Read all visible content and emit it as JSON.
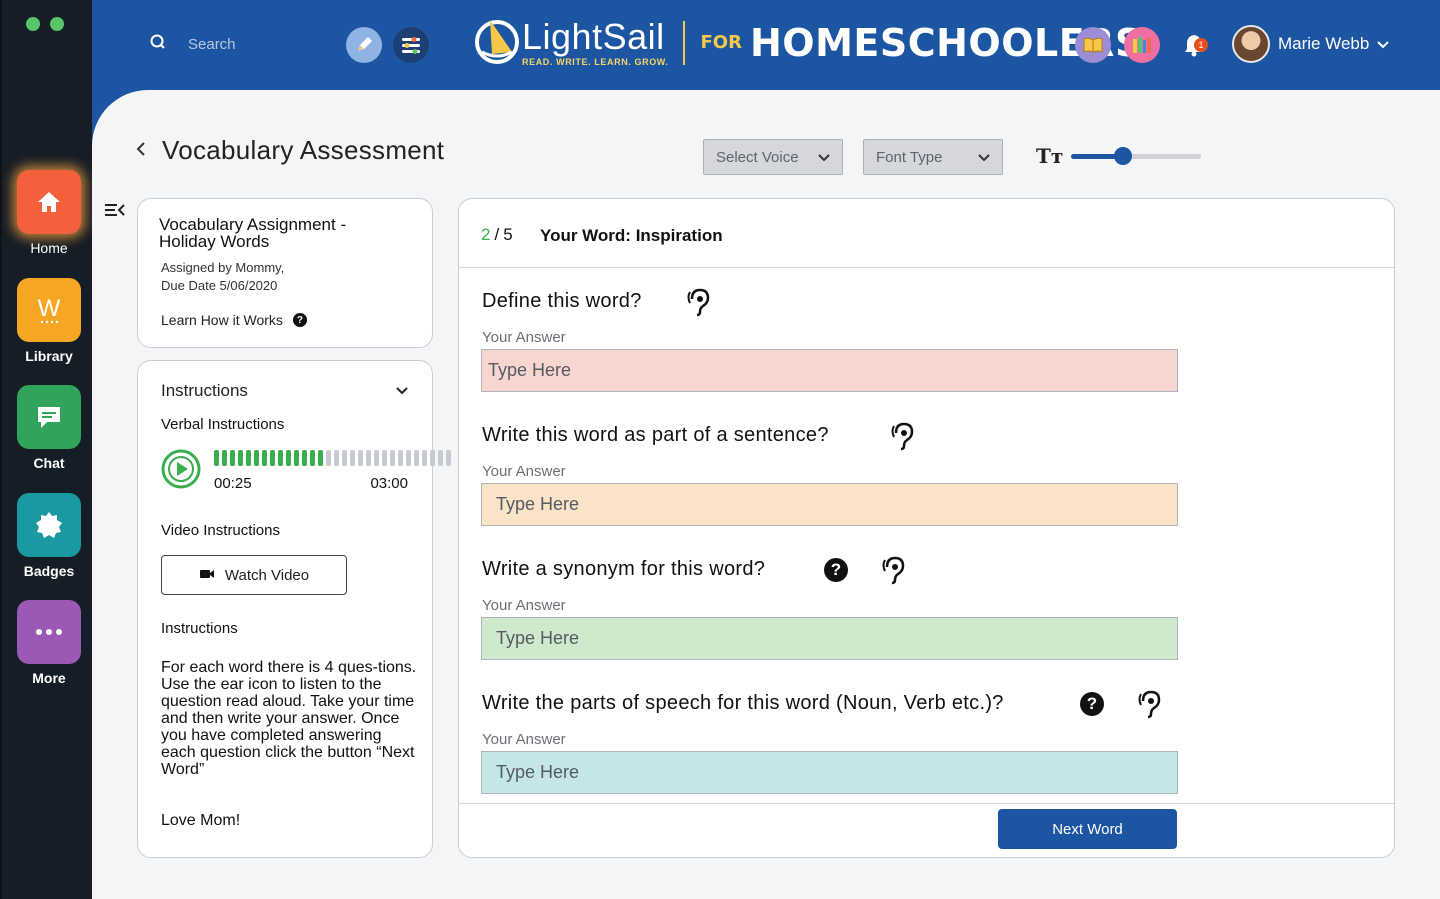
{
  "app": {
    "brand_name": "LightSail",
    "brand_tagline": "READ. WRITE. LEARN. GROW.",
    "brand_for": "FOR",
    "brand_audience": "HOMESCHOOLERS",
    "accent_color": "#1c55a2"
  },
  "header": {
    "search_placeholder": "Search",
    "notification_count": "1",
    "user_name": "Marie Webb"
  },
  "sidebar": {
    "items": [
      {
        "label": "Home",
        "icon": "home-icon",
        "color": "#f2603c"
      },
      {
        "label": "Library",
        "icon": "library-w-icon",
        "color": "#f6a623"
      },
      {
        "label": "Chat",
        "icon": "chat-icon",
        "color": "#2fa45a"
      },
      {
        "label": "Badges",
        "icon": "badge-icon",
        "color": "#1a9aa0"
      },
      {
        "label": "More",
        "icon": "more-icon",
        "color": "#9b59b6"
      }
    ]
  },
  "page": {
    "title": "Vocabulary Assessment",
    "voice_select": "Select Voice",
    "font_select": "Font Type",
    "font_size_icon": "Tт",
    "font_size_level": 0.4
  },
  "assignment": {
    "title_line1": "Vocabulary Assignment -",
    "title_line2": "Holiday Words",
    "assigned_by": "Assigned by Mommy,",
    "due_date": "Due Date 5/06/2020",
    "learn_link": "Learn How it Works"
  },
  "instructions": {
    "header": "Instructions",
    "verbal_label": "Verbal Instructions",
    "time_current": "00:25",
    "time_total": "03:00",
    "progress": 0.45,
    "video_label": "Video Instructions",
    "watch_button": "Watch Video",
    "text_label": "Instructions",
    "body": "For each word there is 4 ques-tions. Use the ear icon to listen to the question read aloud. Take your time and then write your answer. Once you have completed answering each question click the button “Next Word”",
    "signoff": "Love Mom!"
  },
  "assessment": {
    "progress_current": "2",
    "progress_sep": "/",
    "progress_total": "5",
    "word_label": "Your Word: Inspiration",
    "answer_label": "Your Answer",
    "questions": [
      {
        "text": "Define this word?",
        "placeholder": "Type Here",
        "color": "#f9d5d0",
        "help": false
      },
      {
        "text": "Write this word as part of a sentence?",
        "placeholder": "Type Here",
        "color": "#fbe3c7",
        "help": false
      },
      {
        "text": "Write a synonym for this word?",
        "placeholder": "Type Here",
        "color": "#cfe9cd",
        "help": true
      },
      {
        "text": "Write the parts of speech for this word (Noun, Verb etc.)?",
        "placeholder": "Type Here",
        "color": "#c5e6e6",
        "help": true
      }
    ],
    "next_button": "Next Word"
  }
}
